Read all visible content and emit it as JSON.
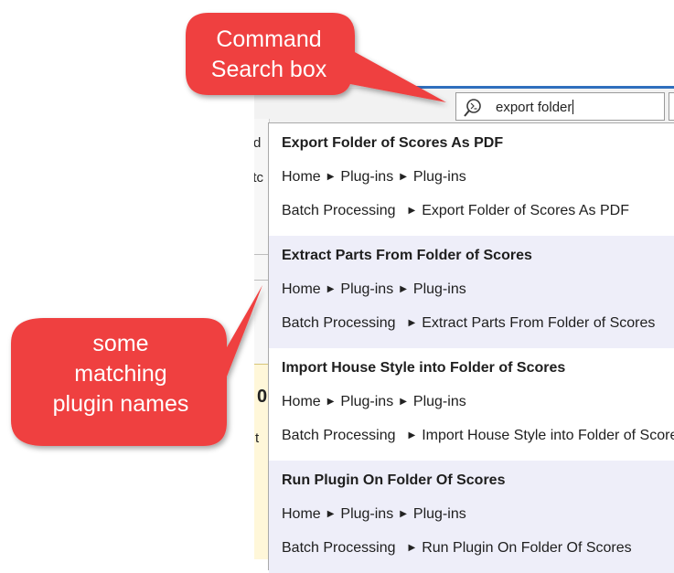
{
  "search": {
    "query": "export folder"
  },
  "callouts": {
    "command_search": [
      "Command",
      "Search box"
    ],
    "matching_names": [
      "some",
      "matching",
      "plugin names"
    ]
  },
  "background_fragments": [
    "d",
    "atc",
    "0",
    "t"
  ],
  "results": [
    {
      "title": "Export Folder of Scores As PDF",
      "path": [
        "Home",
        "Plug-ins",
        "Plug-ins"
      ],
      "category": "Batch Processing",
      "category_item": "Export Folder of Scores As PDF"
    },
    {
      "title": "Extract Parts From Folder of Scores",
      "path": [
        "Home",
        "Plug-ins",
        "Plug-ins"
      ],
      "category": "Batch Processing",
      "category_item": "Extract Parts From Folder of Scores"
    },
    {
      "title": "Import House Style into Folder of Scores",
      "path": [
        "Home",
        "Plug-ins",
        "Plug-ins"
      ],
      "category": "Batch Processing",
      "category_item": "Import House Style into Folder of Scores"
    },
    {
      "title": "Run Plugin On Folder Of Scores",
      "path": [
        "Home",
        "Plug-ins",
        "Plug-ins"
      ],
      "category": "Batch Processing",
      "category_item": "Run Plugin On Folder Of Scores"
    }
  ],
  "colors": {
    "callout_red": "#ef3f3f",
    "row_highlight": "#eeeef9",
    "ribbon_accent": "#2f6fbd"
  }
}
